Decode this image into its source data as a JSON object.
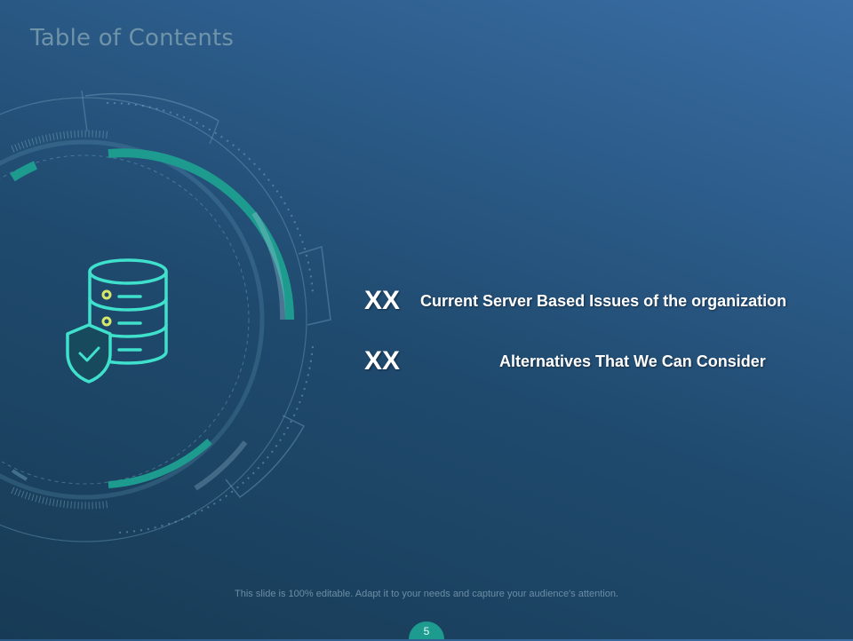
{
  "slide": {
    "title": "Table of Contents",
    "items": [
      {
        "number": "XX",
        "label": "Current Server Based Issues of the organization"
      },
      {
        "number": "XX",
        "label": "Alternatives  That We Can Consider"
      }
    ],
    "footer_note": "This slide is 100% editable. Adapt it to your needs and capture your audience's attention.",
    "page_number": "5"
  },
  "colors": {
    "accent": "#1e9b8f",
    "icon_stroke": "#3fe0cc",
    "icon_dot": "#d6e86a"
  },
  "icons": [
    "database-icon",
    "shield-check-icon"
  ]
}
